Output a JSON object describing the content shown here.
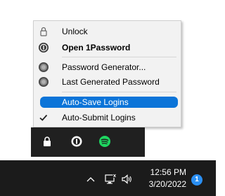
{
  "menu": {
    "unlock": "Unlock",
    "open": "Open 1Password",
    "generator": "Password Generator...",
    "last_generated": "Last Generated Password",
    "auto_save": "Auto-Save Logins",
    "auto_submit": "Auto-Submit Logins"
  },
  "taskbar": {
    "time": "12:56 PM",
    "date": "3/20/2022",
    "notification_count": "1"
  },
  "colors": {
    "highlight": "#0b74d8",
    "spotify": "#1ed760",
    "badge": "#2a8ff3"
  }
}
